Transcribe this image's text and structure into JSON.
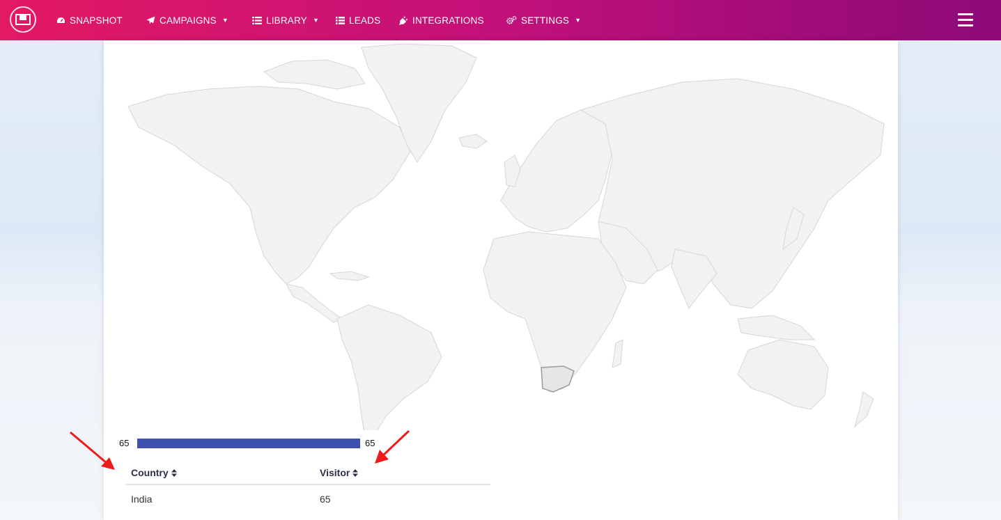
{
  "nav": {
    "items": [
      {
        "label": "SNAPSHOT",
        "icon": "dashboard-icon"
      },
      {
        "label": "CAMPAIGNS",
        "icon": "paper-plane-icon",
        "dropdown": true
      },
      {
        "label": "LIBRARY",
        "icon": "library-icon",
        "dropdown": true
      },
      {
        "label": "LEADS",
        "icon": "list-icon"
      },
      {
        "label": "INTEGRATIONS",
        "icon": "plug-icon"
      },
      {
        "label": "SETTINGS",
        "icon": "cogs-icon",
        "dropdown": true
      }
    ],
    "menu_icon": "hamburger-icon",
    "colors": {
      "gradient_start": "#e31963",
      "gradient_end": "#8c0a78"
    }
  },
  "map": {
    "legend_min": "65",
    "legend_max": "65",
    "legend_color": "#3d50b0",
    "highlighted_country": "South Africa"
  },
  "table": {
    "columns": [
      "Country",
      "Visitor"
    ],
    "rows": [
      {
        "country": "India",
        "visitor": "65"
      }
    ]
  }
}
